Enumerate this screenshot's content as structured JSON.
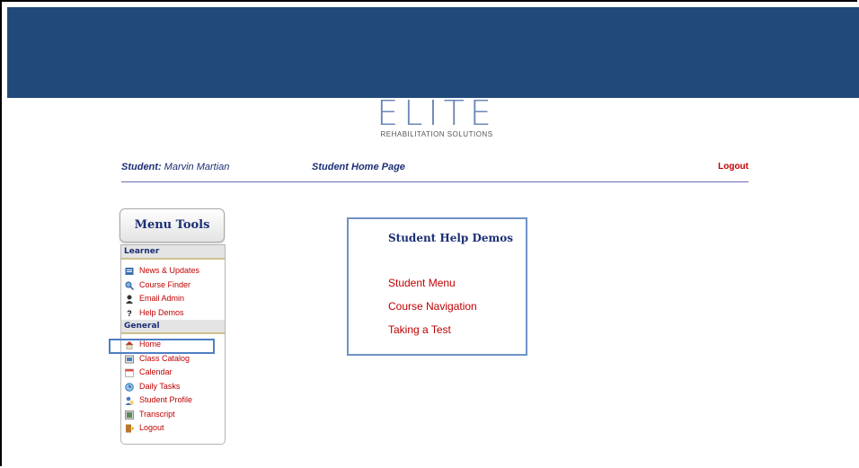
{
  "brand": {
    "logo_text": "ELITE",
    "logo_subtitle": "REHABILITATION SOLUTIONS",
    "colors": {
      "banner": "#21497a",
      "accent_blue": "#1c2f75",
      "link_red": "#c00000",
      "highlight": "#4f7fc1"
    }
  },
  "header": {
    "student_prefix": "Student:",
    "student_name": "Marvin Martian",
    "page_title": "Student Home Page",
    "logout": "Logout"
  },
  "menu": {
    "title": "Menu Tools",
    "learner": {
      "heading": "Learner",
      "items": [
        {
          "label": "News & Updates",
          "icon": "news-icon"
        },
        {
          "label": "Course Finder",
          "icon": "search-icon"
        },
        {
          "label": "Email Admin",
          "icon": "user-icon"
        },
        {
          "label": "Help Demos",
          "icon": "help-icon"
        }
      ]
    },
    "general": {
      "heading": "General",
      "items": [
        {
          "label": "Home",
          "icon": "home-icon"
        },
        {
          "label": "Class Catalog",
          "icon": "catalog-icon"
        },
        {
          "label": "Calendar",
          "icon": "calendar-icon"
        },
        {
          "label": "Daily Tasks",
          "icon": "clock-icon"
        },
        {
          "label": "Student Profile",
          "icon": "profile-icon"
        },
        {
          "label": "Transcript",
          "icon": "transcript-icon"
        },
        {
          "label": "Logout",
          "icon": "logout-icon"
        }
      ]
    }
  },
  "help": {
    "title": "Student Help Demos",
    "links": [
      "Student Menu",
      "Course Navigation",
      "Taking a Test"
    ]
  }
}
